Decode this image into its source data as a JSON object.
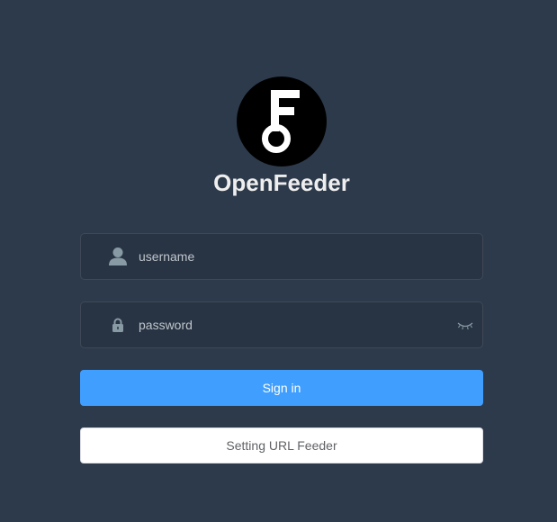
{
  "app": {
    "title": "OpenFeeder"
  },
  "login_form": {
    "username": {
      "value": "",
      "placeholder": "username",
      "icon": "user-icon"
    },
    "password": {
      "value": "",
      "placeholder": "password",
      "icon": "lock-icon",
      "toggle_icon": "eye-closed-icon"
    }
  },
  "buttons": {
    "sign_in_label": "Sign in",
    "setting_url_label": "Setting URL Feeder"
  },
  "colors": {
    "background": "#2d3a4b",
    "primary": "#409eff",
    "logo_background": "#000000"
  }
}
